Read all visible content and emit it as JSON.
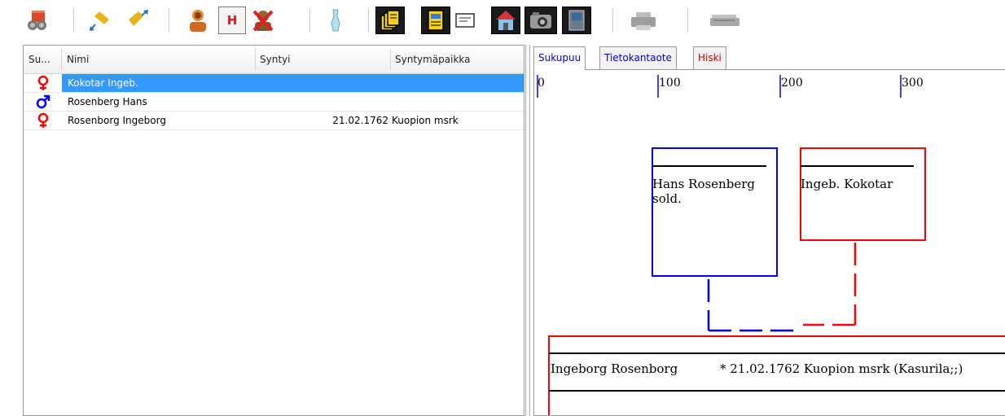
{
  "toolbar": {
    "buttons": [
      {
        "name": "database-icon",
        "active": false
      },
      {
        "name": "pin-down-icon",
        "active": false
      },
      {
        "name": "pin-up-icon",
        "active": false
      },
      {
        "name": "person-icon",
        "active": false
      },
      {
        "name": "h-button",
        "label": "H",
        "active": true
      },
      {
        "name": "delete-person-icon",
        "active": false
      },
      {
        "name": "tree-icon",
        "active": false
      },
      {
        "name": "documents-icon",
        "active": false
      },
      {
        "name": "page-icon",
        "active": false
      },
      {
        "name": "card-icon",
        "active": false
      },
      {
        "name": "house-icon",
        "active": false
      },
      {
        "name": "camera-icon",
        "active": false
      },
      {
        "name": "door-icon",
        "active": false
      },
      {
        "name": "printer-icon",
        "active": false
      },
      {
        "name": "scanner-icon",
        "active": false
      }
    ]
  },
  "list": {
    "columns": [
      "Su...",
      "Nimi",
      "Syntyi",
      "Syntymäpaikka"
    ],
    "rows": [
      {
        "sex": "female",
        "name": "Kokotar Ingeb.",
        "born": "",
        "place": "",
        "selected": true
      },
      {
        "sex": "male",
        "name": "Rosenberg Hans",
        "born": "",
        "place": "",
        "selected": false
      },
      {
        "sex": "female",
        "name": "Rosenborg Ingeborg",
        "born": "21.02.1762",
        "place": "Kuopion msrk",
        "selected": false
      }
    ]
  },
  "tabs": [
    {
      "label": "Sukupuu",
      "color": "#0000cc",
      "active": true
    },
    {
      "label": "Tietokantaote",
      "color": "#0000cc",
      "active": false
    },
    {
      "label": "Hiski",
      "color": "#cc0000",
      "active": false
    }
  ],
  "tree": {
    "ruler": [
      "0",
      "100",
      "200",
      "300"
    ],
    "father": {
      "name": "Hans Rosenberg",
      "note": "sold.",
      "color": "#0000ff"
    },
    "mother": {
      "name": "Ingeb. Kokotar",
      "color": "#ff0000"
    },
    "child": {
      "name": "Ingeborg Rosenborg",
      "details": "* 21.02.1762  Kuopion msrk (Kasurila;;)",
      "color": "#ff0000"
    }
  },
  "colors": {
    "selection": "#3399ff",
    "male": "#0000ff",
    "female": "#ff0000"
  }
}
